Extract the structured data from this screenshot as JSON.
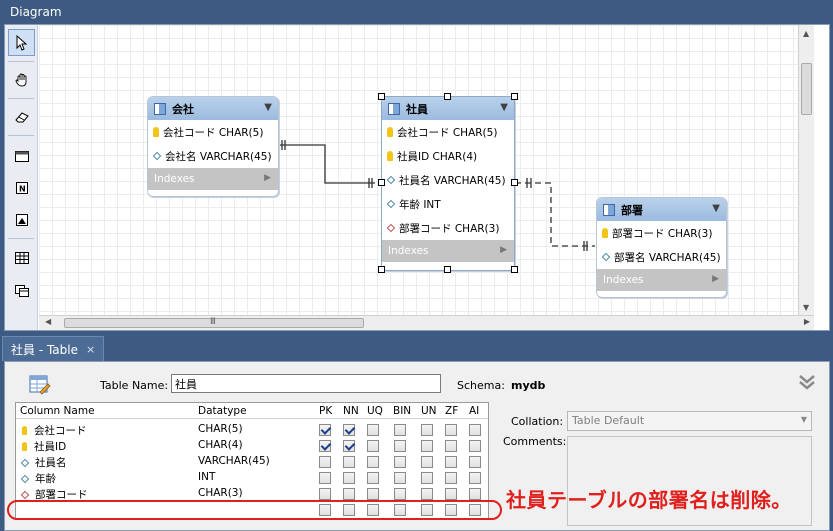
{
  "diagram": {
    "title": "Diagram",
    "entities": {
      "kaisha": {
        "name": "会社",
        "columns": [
          {
            "text": "会社コード CHAR(5)",
            "icon": "key-icon"
          },
          {
            "text": "会社名 VARCHAR(45)",
            "icon": "diamond-icon"
          }
        ],
        "indexes_label": "Indexes"
      },
      "shain": {
        "name": "社員",
        "columns": [
          {
            "text": "会社コード CHAR(5)",
            "icon": "key-icon"
          },
          {
            "text": "社員ID CHAR(4)",
            "icon": "key-icon"
          },
          {
            "text": "社員名 VARCHAR(45)",
            "icon": "diamond-filled-icon"
          },
          {
            "text": "年齢 INT",
            "icon": "diamond-icon"
          },
          {
            "text": "部署コード CHAR(3)",
            "icon": "diamond-red-icon"
          }
        ],
        "indexes_label": "Indexes"
      },
      "busho": {
        "name": "部署",
        "columns": [
          {
            "text": "部署コード CHAR(3)",
            "icon": "key-icon"
          },
          {
            "text": "部署名 VARCHAR(45)",
            "icon": "diamond-icon"
          }
        ],
        "indexes_label": "Indexes"
      }
    },
    "tools": [
      "pointer-icon",
      "hand-icon",
      "eraser-icon",
      "layer-icon",
      "note-icon",
      "image-icon",
      "table-tool-icon",
      "view-tool-icon"
    ],
    "hscroll_grip": "III"
  },
  "tab": {
    "label": "社員 - Table",
    "close": "×"
  },
  "editor": {
    "table_name_label": "Table Name:",
    "table_name_value": "社員",
    "schema_label": "Schema:",
    "schema_value": "mydb",
    "collation_label": "Collation:",
    "collation_value": "Table Default",
    "comments_label": "Comments:",
    "grid": {
      "headers": [
        "Column Name",
        "Datatype",
        "PK",
        "NN",
        "UQ",
        "BIN",
        "UN",
        "ZF",
        "AI"
      ],
      "rows": [
        {
          "name": "会社コード",
          "type": "CHAR(5)",
          "icon": "key-icon",
          "flags": [
            true,
            true,
            false,
            false,
            false,
            false,
            false
          ]
        },
        {
          "name": "社員ID",
          "type": "CHAR(4)",
          "icon": "key-icon",
          "flags": [
            true,
            true,
            false,
            false,
            false,
            false,
            false
          ]
        },
        {
          "name": "社員名",
          "type": "VARCHAR(45)",
          "icon": "diamond-icon",
          "flags": [
            false,
            false,
            false,
            false,
            false,
            false,
            false
          ]
        },
        {
          "name": "年齢",
          "type": "INT",
          "icon": "diamond-icon",
          "flags": [
            false,
            false,
            false,
            false,
            false,
            false,
            false
          ]
        },
        {
          "name": "部署コード",
          "type": "CHAR(3)",
          "icon": "diamond-red-icon",
          "flags": [
            false,
            false,
            false,
            false,
            false,
            false,
            false
          ]
        },
        {
          "name": "",
          "type": "",
          "icon": "",
          "flags": [
            false,
            false,
            false,
            false,
            false,
            false,
            false
          ]
        }
      ]
    }
  },
  "annotation": {
    "text": "社員テーブルの部署名は削除。",
    "color": "#e0201c"
  },
  "colors": {
    "frame": "#3d5b82",
    "entity_header": "#a9c6e6",
    "indexes_bar": "#c4c4c4"
  }
}
